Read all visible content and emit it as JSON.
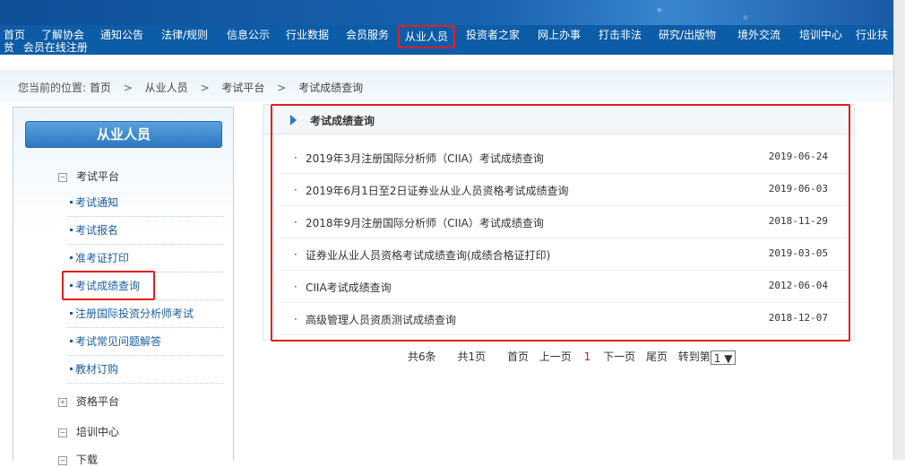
{
  "nav": {
    "items": [
      "首页",
      "了解协会",
      "通知公告",
      "法律/规则",
      "信息公示",
      "行业数据",
      "会员服务",
      "从业人员",
      "投资者之家",
      "网上办事",
      "打击非法",
      "研究/出版物",
      "境外交流",
      "培训中心",
      "行业扶"
    ],
    "line2_a": "贫",
    "line2_b": "会员在线注册"
  },
  "breadcrumb": {
    "prefix": "您当前的位置:",
    "items": [
      "首页",
      "从业人员",
      "考试平台",
      "考试成绩查询"
    ],
    "separator": ">"
  },
  "sidebar": {
    "title": "从业人员",
    "groups": [
      {
        "label": "考试平台",
        "state": "⊟"
      },
      {
        "label": "资格平台",
        "state": "⊞"
      },
      {
        "label": "培训中心",
        "state": "⊟"
      },
      {
        "label": "下载",
        "state": "⊟"
      }
    ],
    "subitems": [
      "考试通知",
      "考试报名",
      "准考证打印",
      "考试成绩查询",
      "注册国际投资分析师考试",
      "考试常见问题解答",
      "教材订购"
    ]
  },
  "panel": {
    "title": "考试成绩查询",
    "rows": [
      {
        "title": "2019年3月注册国际分析师（CIIA）考试成绩查询",
        "date": "2019-06-24"
      },
      {
        "title": "2019年6月1日至2日证券业从业人员资格考试成绩查询",
        "date": "2019-06-03"
      },
      {
        "title": "2018年9月注册国际分析师（CIIA）考试成绩查询",
        "date": "2018-11-29"
      },
      {
        "title": "证券业从业人员资格考试成绩查询(成绩合格证打印)",
        "date": "2019-03-05"
      },
      {
        "title": "CIIA考试成绩查询",
        "date": "2012-06-04"
      },
      {
        "title": "高级管理人员资质测试成绩查询",
        "date": "2018-12-07"
      }
    ]
  },
  "pager": {
    "total": "共6条",
    "pages": "共1页",
    "first": "首页",
    "prev": "上一页",
    "current": "1",
    "next": "下一页",
    "last": "尾页",
    "goto": "转到第",
    "selected": "1 ▼"
  },
  "colors": {
    "nav_bg": "#0c5ca8",
    "highlight": "#e02020",
    "link": "#1d5ea4"
  }
}
